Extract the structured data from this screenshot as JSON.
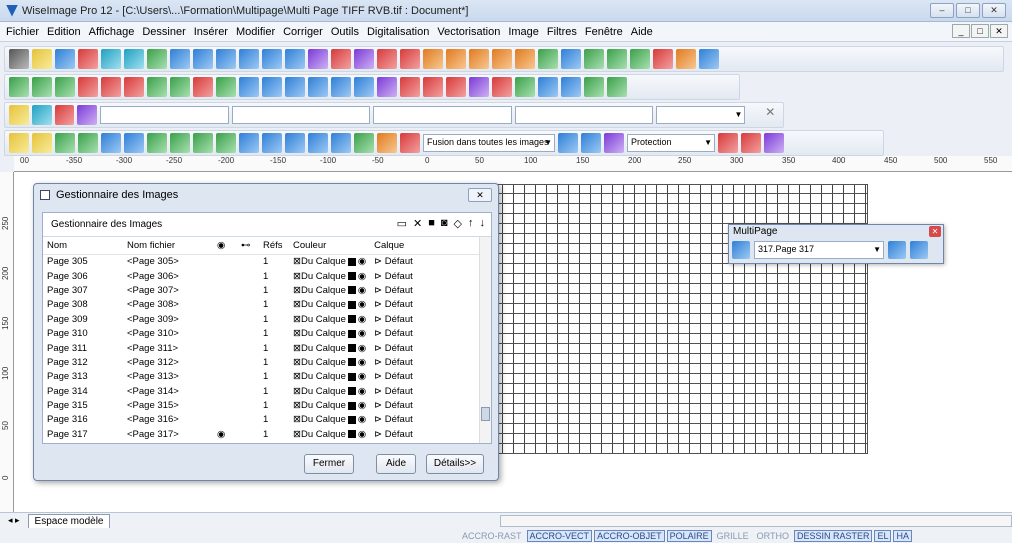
{
  "window": {
    "title": "WiseImage Pro 12 - [C:\\Users\\...\\Formation\\Multipage\\Multi Page TIFF RVB.tif : Document*]",
    "controls": [
      "–",
      "□",
      "✕"
    ]
  },
  "menu": {
    "items": [
      "Fichier",
      "Edition",
      "Affichage",
      "Dessiner",
      "Insérer",
      "Modifier",
      "Corriger",
      "Outils",
      "Digitalisation",
      "Vectorisation",
      "Image",
      "Filtres",
      "Fenêtre",
      "Aide"
    ],
    "mdi_controls": [
      "_",
      "□",
      "✕"
    ]
  },
  "toolbar4": {
    "fusion_combo": "Fusion dans toutes les images",
    "protection_combo": "Protection"
  },
  "ruler": {
    "ticks": [
      "00",
      "-350",
      "-300",
      "-250",
      "-200",
      "-150",
      "-100",
      "-50",
      "0",
      "50",
      "100",
      "150",
      "200",
      "250",
      "300",
      "350",
      "400",
      "450",
      "500",
      "550"
    ],
    "vticks": [
      "250",
      "200",
      "150",
      "100",
      "50",
      "0"
    ]
  },
  "dialog": {
    "title": "Gestionnaire des Images",
    "panel_title": "Gestionnaire des Images",
    "columns": [
      "Nom",
      "Nom fichier",
      "◉",
      "⊷",
      "Réfs",
      "Couleur",
      "Calque"
    ],
    "rows": [
      {
        "nom": "Page 305",
        "fichier": "<Page 305>",
        "vis": "",
        "refs": "1",
        "couleur": "⊠Du Calque",
        "calque": "Défaut"
      },
      {
        "nom": "Page 306",
        "fichier": "<Page 306>",
        "vis": "",
        "refs": "1",
        "couleur": "⊠Du Calque",
        "calque": "Défaut"
      },
      {
        "nom": "Page 307",
        "fichier": "<Page 307>",
        "vis": "",
        "refs": "1",
        "couleur": "⊠Du Calque",
        "calque": "Défaut"
      },
      {
        "nom": "Page 308",
        "fichier": "<Page 308>",
        "vis": "",
        "refs": "1",
        "couleur": "⊠Du Calque",
        "calque": "Défaut"
      },
      {
        "nom": "Page 309",
        "fichier": "<Page 309>",
        "vis": "",
        "refs": "1",
        "couleur": "⊠Du Calque",
        "calque": "Défaut"
      },
      {
        "nom": "Page 310",
        "fichier": "<Page 310>",
        "vis": "",
        "refs": "1",
        "couleur": "⊠Du Calque",
        "calque": "Défaut"
      },
      {
        "nom": "Page 311",
        "fichier": "<Page 311>",
        "vis": "",
        "refs": "1",
        "couleur": "⊠Du Calque",
        "calque": "Défaut"
      },
      {
        "nom": "Page 312",
        "fichier": "<Page 312>",
        "vis": "",
        "refs": "1",
        "couleur": "⊠Du Calque",
        "calque": "Défaut"
      },
      {
        "nom": "Page 313",
        "fichier": "<Page 313>",
        "vis": "",
        "refs": "1",
        "couleur": "⊠Du Calque",
        "calque": "Défaut"
      },
      {
        "nom": "Page 314",
        "fichier": "<Page 314>",
        "vis": "",
        "refs": "1",
        "couleur": "⊠Du Calque",
        "calque": "Défaut"
      },
      {
        "nom": "Page 315",
        "fichier": "<Page 315>",
        "vis": "",
        "refs": "1",
        "couleur": "⊠Du Calque",
        "calque": "Défaut"
      },
      {
        "nom": "Page 316",
        "fichier": "<Page 316>",
        "vis": "",
        "refs": "1",
        "couleur": "⊠Du Calque",
        "calque": "Défaut"
      },
      {
        "nom": "Page 317",
        "fichier": "<Page 317>",
        "vis": "◉",
        "refs": "1",
        "couleur": "⊠Du Calque",
        "calque": "Défaut"
      }
    ],
    "buttons": {
      "close": "Fermer",
      "help": "Aide",
      "details": "Détails>>"
    }
  },
  "multipage": {
    "title": "MultiPage",
    "selected": "317.Page 317"
  },
  "bottom": {
    "model_tab": "Espace modèle",
    "status": [
      {
        "label": "ACCRO-RAST",
        "on": false
      },
      {
        "label": "ACCRO-VECT",
        "on": true
      },
      {
        "label": "ACCRO-OBJET",
        "on": true
      },
      {
        "label": "POLAIRE",
        "on": true
      },
      {
        "label": "GRILLE",
        "on": false
      },
      {
        "label": "ORTHO",
        "on": false
      },
      {
        "label": "DESSIN RASTER",
        "on": true
      },
      {
        "label": "EL",
        "on": true
      },
      {
        "label": "HA",
        "on": true
      }
    ]
  }
}
